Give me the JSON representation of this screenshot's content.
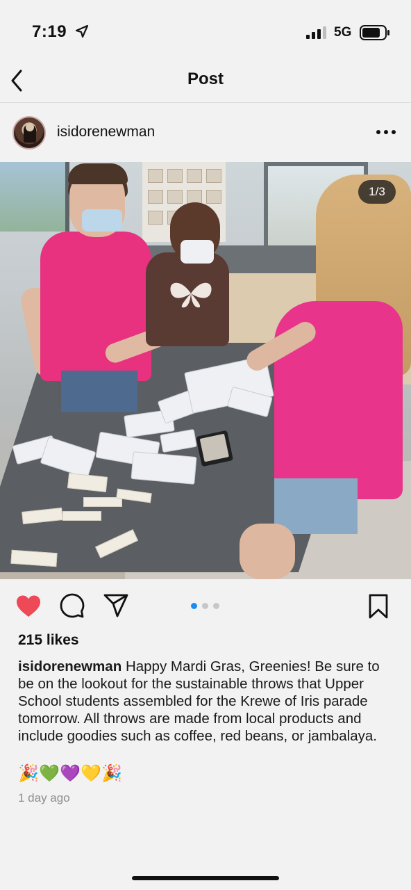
{
  "status_bar": {
    "time": "7:19",
    "network": "5G",
    "icons": [
      "location-arrow-icon",
      "signal-bars-icon",
      "battery-icon"
    ]
  },
  "nav": {
    "title": "Post",
    "back_icon": "chevron-left-icon"
  },
  "post": {
    "username": "isidorenewman",
    "avatar": "profile-avatar",
    "more_icon": "ellipsis-icon",
    "carousel_counter": "1/3",
    "carousel_total": 3,
    "carousel_current": 1,
    "likes": "215 likes",
    "caption_user": "isidorenewman",
    "caption_text": "Happy Mardi Gras, Greenies! Be sure to be on the lookout for the sustainable throws that Upper School students assembled for the Krewe of Iris parade tomorrow. All throws are made from local products and include goodies such as coffee, red beans, or jambalaya.",
    "emojis": [
      "🎉",
      "💚",
      "💜",
      "💛",
      "🎉"
    ],
    "timestamp": "1 day ago",
    "liked": true,
    "colors": {
      "like": "#ed4956",
      "active_dot": "#1a8cf2",
      "inactive_dot": "#c7c7c7"
    }
  },
  "actions": {
    "icons": [
      "heart-icon",
      "comment-icon",
      "share-icon",
      "bookmark-icon"
    ]
  }
}
